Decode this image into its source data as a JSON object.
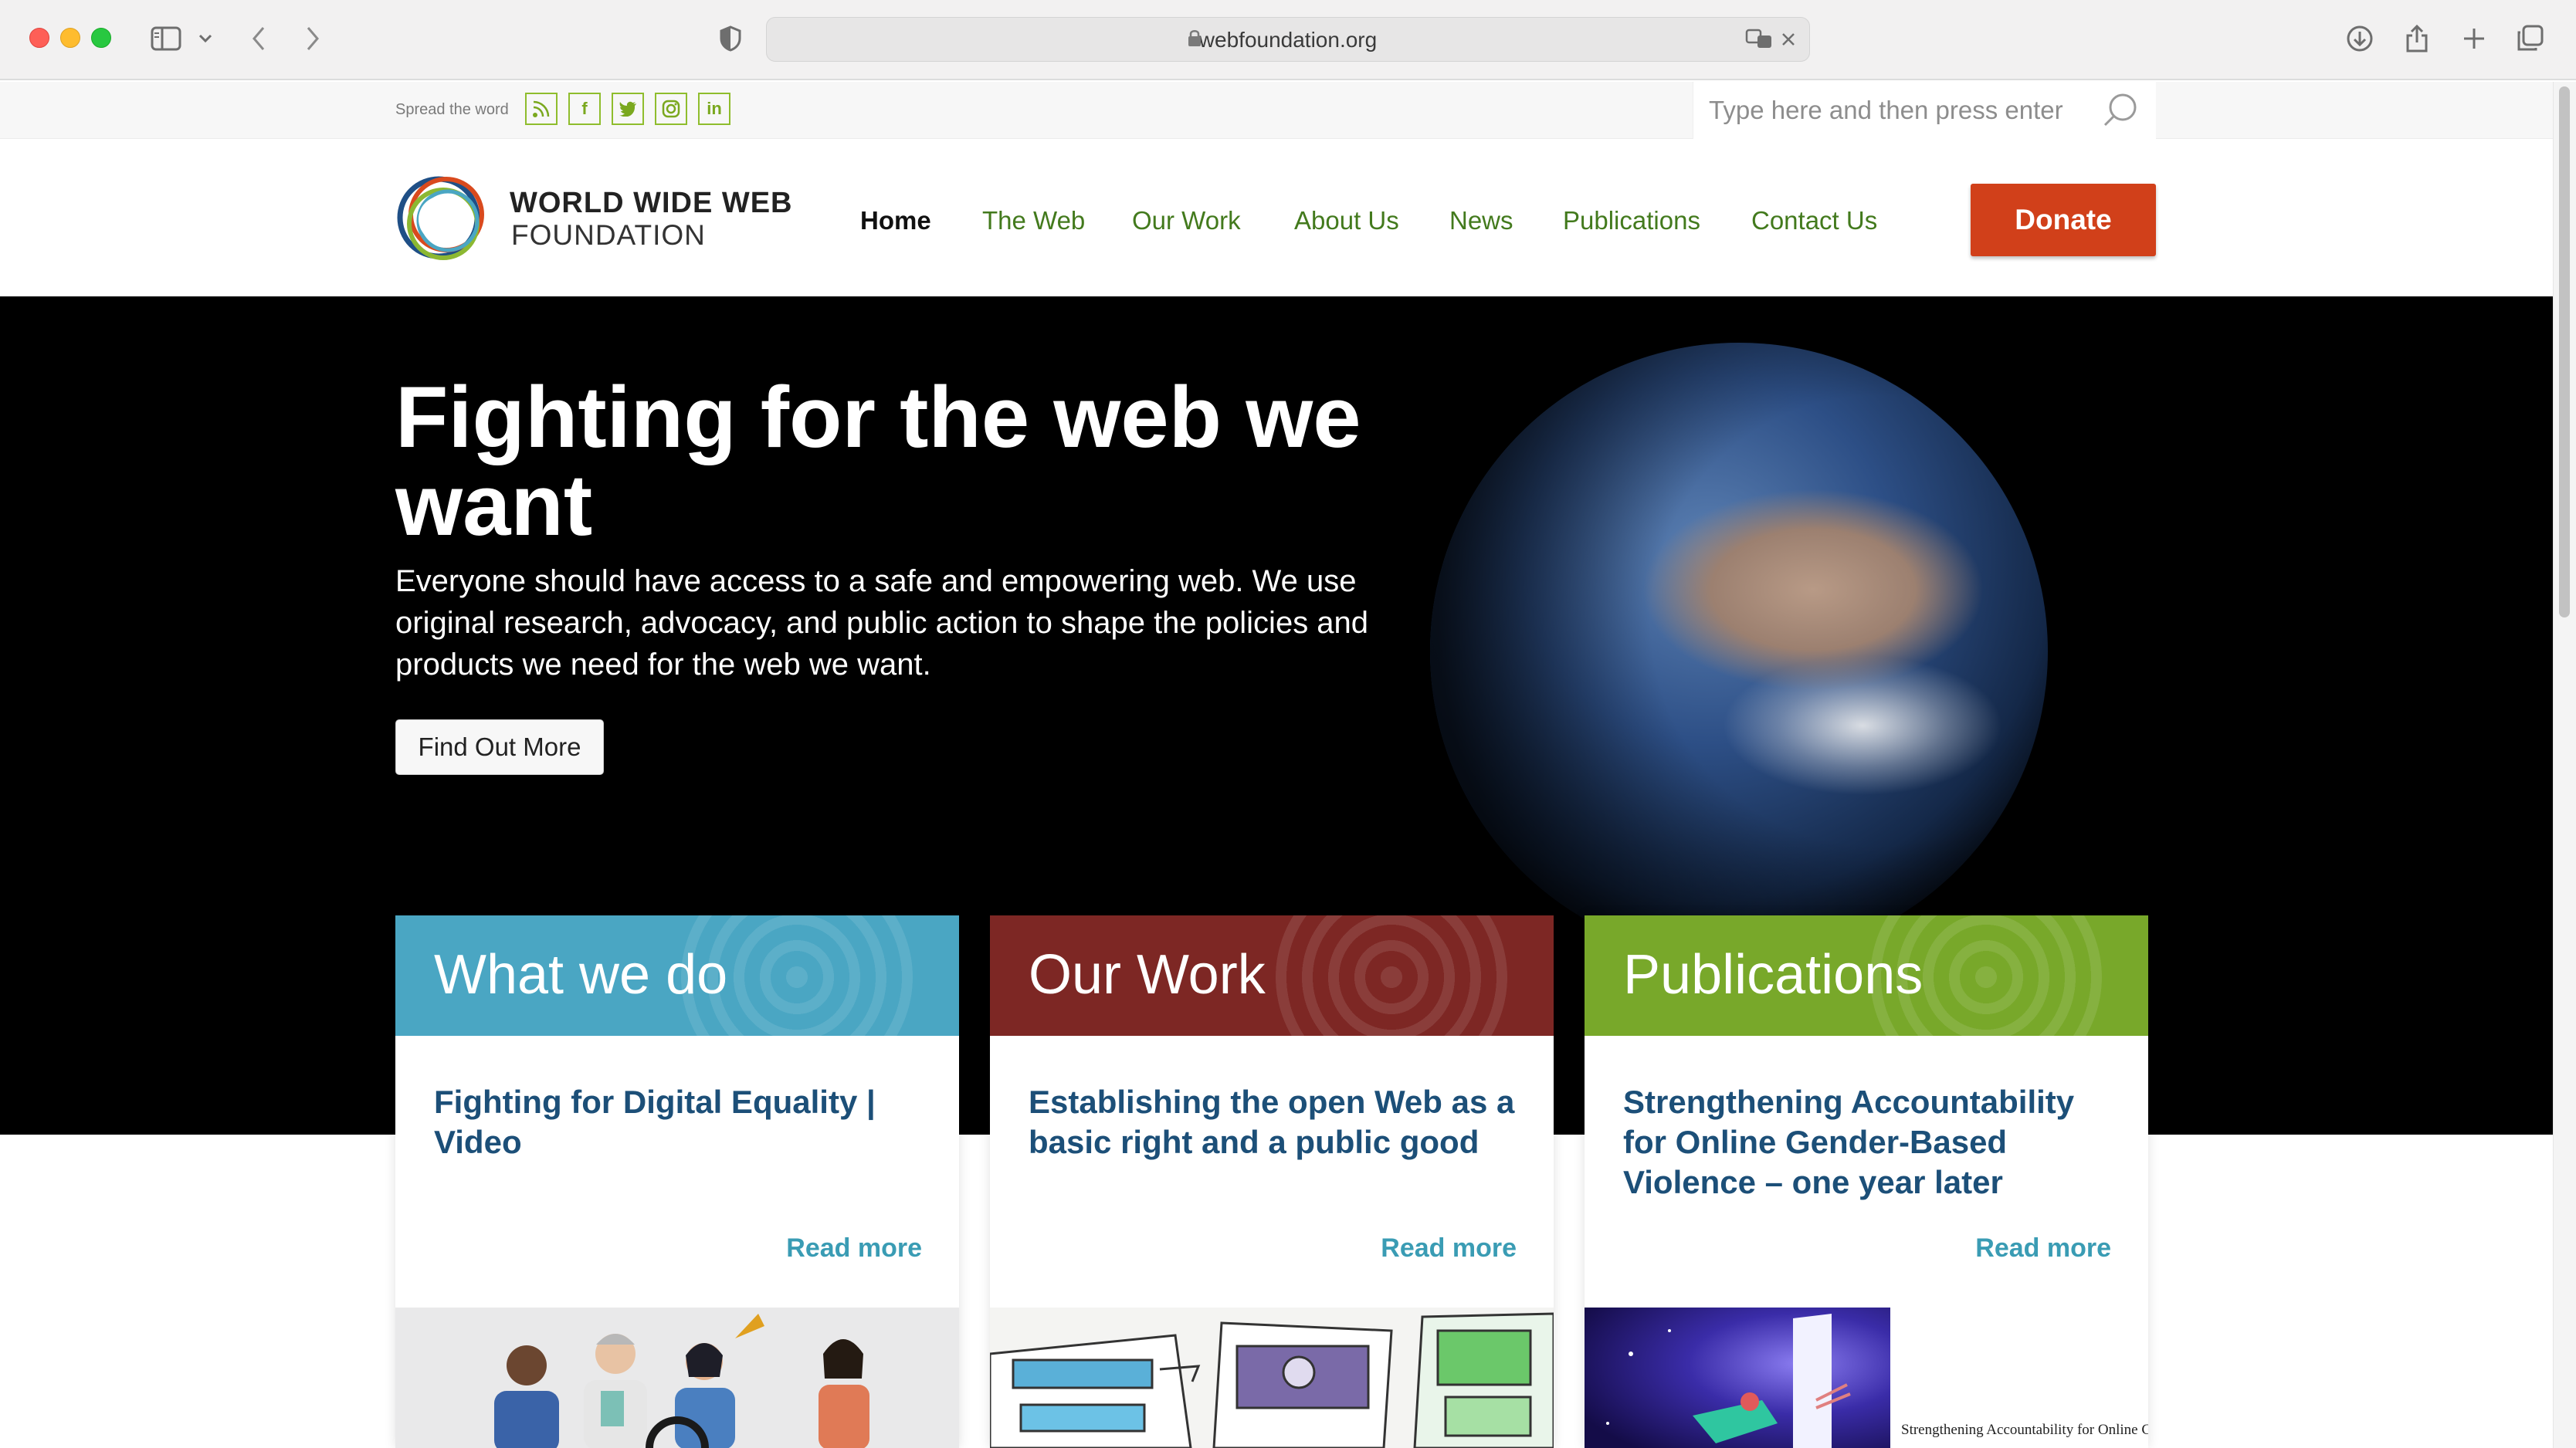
{
  "browser": {
    "url": "webfoundation.org"
  },
  "topbar": {
    "spread_label": "Spread the word",
    "social": [
      {
        "icon": "rss-icon",
        "glyph": "))"
      },
      {
        "icon": "facebook-icon",
        "glyph": "f"
      },
      {
        "icon": "twitter-icon",
        "glyph": "t"
      },
      {
        "icon": "instagram-icon",
        "glyph": "◎"
      },
      {
        "icon": "linkedin-icon",
        "glyph": "in"
      }
    ],
    "search_placeholder": "Type here and then press enter"
  },
  "header": {
    "logo_line1": "WORLD WIDE WEB",
    "logo_line2": "FOUNDATION",
    "nav": [
      "Home",
      "The Web",
      "Our Work",
      "About Us",
      "News",
      "Publications",
      "Contact Us"
    ],
    "active_nav": "Home",
    "donate_label": "Donate"
  },
  "hero": {
    "title": "Fighting for the web we want",
    "description": "Everyone should have access to a safe and empowering web. We use original research, advocacy, and public action to shape the policies and products we need for the web we want.",
    "button_label": "Find Out More"
  },
  "cards": [
    {
      "title": "What we do",
      "link": "Fighting for Digital Equality | Video",
      "read_more": "Read more",
      "color": "#4aa6c3"
    },
    {
      "title": "Our Work",
      "link": "Establishing the open Web as a basic right and a public good",
      "read_more": "Read more",
      "color": "#7d2724"
    },
    {
      "title": "Publications",
      "link": "Strengthening Accountability for Online Gender-Based Violence – one year later",
      "read_more": "Read more",
      "color": "#78a82a",
      "image_caption": "Strengthening Accountability for Online Gender-Based Violence"
    }
  ],
  "colors": {
    "accent_green": "#437a1d",
    "donate": "#d1401a",
    "link_blue": "#1c4f78"
  }
}
